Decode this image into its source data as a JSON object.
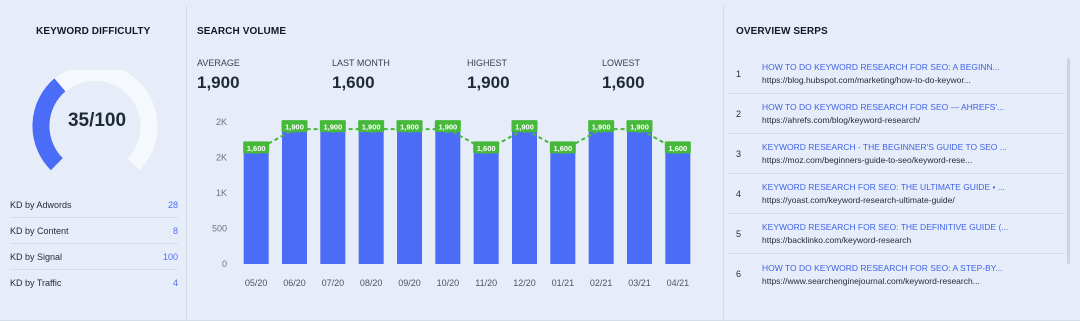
{
  "keyword_difficulty": {
    "title": "KEYWORD DIFFICULTY",
    "score": 35,
    "score_text": "35/100",
    "breakdown": [
      {
        "label": "KD by Adwords",
        "value": "28"
      },
      {
        "label": "KD by Content",
        "value": "8"
      },
      {
        "label": "KD by Signal",
        "value": "100"
      },
      {
        "label": "KD by Traffic",
        "value": "4"
      }
    ]
  },
  "search_volume": {
    "title": "SEARCH VOLUME",
    "stats": [
      {
        "label": "AVERAGE",
        "value": "1,900"
      },
      {
        "label": "LAST MONTH",
        "value": "1,600"
      },
      {
        "label": "HIGHEST",
        "value": "1,900"
      },
      {
        "label": "LOWEST",
        "value": "1,600"
      }
    ]
  },
  "chart_data": {
    "type": "bar",
    "categories": [
      "05/20",
      "06/20",
      "07/20",
      "08/20",
      "09/20",
      "10/20",
      "11/20",
      "12/20",
      "01/21",
      "02/21",
      "03/21",
      "04/21"
    ],
    "values": [
      1600,
      1900,
      1900,
      1900,
      1900,
      1900,
      1600,
      1900,
      1600,
      1900,
      1900,
      1600
    ],
    "data_labels": [
      "1,600",
      "1,900",
      "1,900",
      "1,900",
      "1,900",
      "1,900",
      "1,600",
      "1,900",
      "1,600",
      "1,900",
      "1,900",
      "1,600"
    ],
    "y_ticks": [
      {
        "value": 0,
        "label": "0"
      },
      {
        "value": 500,
        "label": "500"
      },
      {
        "value": 1000,
        "label": "1K"
      },
      {
        "value": 1500,
        "label": "2K"
      },
      {
        "value": 2000,
        "label": "2K"
      }
    ],
    "ylim": [
      0,
      2000
    ],
    "grid": false,
    "colors": {
      "bar": "#4a6cf7",
      "line": "#46b83a",
      "label_bg": "#46b83a"
    }
  },
  "overview_serps": {
    "title": "OVERVIEW SERPS",
    "items": [
      {
        "rank": "1",
        "title": "HOW TO DO KEYWORD RESEARCH FOR SEO: A BEGINN...",
        "url": "https://blog.hubspot.com/marketing/how-to-do-keywor..."
      },
      {
        "rank": "2",
        "title": "HOW TO DO KEYWORD RESEARCH FOR SEO — AHREFS'...",
        "url": "https://ahrefs.com/blog/keyword-research/"
      },
      {
        "rank": "3",
        "title": "KEYWORD RESEARCH - THE BEGINNER'S GUIDE TO SEO ...",
        "url": "https://moz.com/beginners-guide-to-seo/keyword-rese..."
      },
      {
        "rank": "4",
        "title": "KEYWORD RESEARCH FOR SEO: THE ULTIMATE GUIDE • ...",
        "url": "https://yoast.com/keyword-research-ultimate-guide/"
      },
      {
        "rank": "5",
        "title": "KEYWORD RESEARCH FOR SEO: THE DEFINITIVE GUIDE (...",
        "url": "https://backlinko.com/keyword-research"
      },
      {
        "rank": "6",
        "title": "HOW TO DO KEYWORD RESEARCH FOR SEO: A STEP-BY...",
        "url": "https://www.searchenginejournal.com/keyword-research..."
      }
    ]
  },
  "colors": {
    "accent": "#4a6cf7",
    "green": "#46b83a",
    "gauge_track": "#f5f8fd",
    "link": "#3f62e8"
  }
}
